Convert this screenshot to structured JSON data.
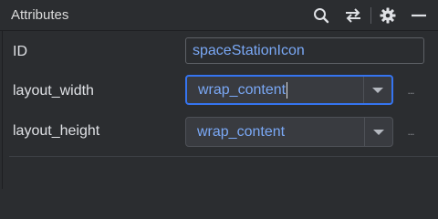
{
  "header": {
    "title": "Attributes",
    "icons": [
      "search-icon",
      "swap-icon",
      "gear-icon",
      "minimize-icon"
    ]
  },
  "rows": [
    {
      "label": "ID",
      "value": "spaceStationIcon",
      "control": "text-input"
    },
    {
      "label": "layout_width",
      "value": "wrap_content",
      "control": "combo",
      "focused": true
    },
    {
      "label": "layout_height",
      "value": "wrap_content",
      "control": "combo",
      "focused": false
    }
  ],
  "more_button_label": "...",
  "colors": {
    "background": "#2b2d30",
    "value_text": "#7aa8f5",
    "focus_border": "#3574f0",
    "label_text": "#dfe1e5"
  }
}
